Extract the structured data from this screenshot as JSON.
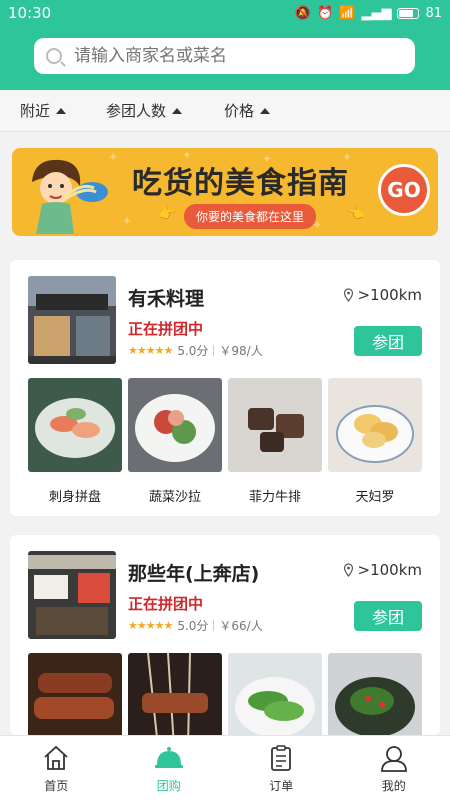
{
  "status_bar": {
    "time": "10:30",
    "battery": "81"
  },
  "search": {
    "placeholder": "请输入商家名或菜名"
  },
  "filters": [
    {
      "label": "附近"
    },
    {
      "label": "参团人数"
    },
    {
      "label": "价格"
    }
  ],
  "banner": {
    "title": "吃货的美食指南",
    "subtitle": "你要的美食都在这里",
    "go": "GO"
  },
  "shops": [
    {
      "name": "有禾料理",
      "distance": ">100km",
      "status": "正在拼团中",
      "rating": "5.0分",
      "price": "￥98/人",
      "join_label": "参团",
      "dishes": [
        {
          "name": "刺身拼盘"
        },
        {
          "name": "蔬菜沙拉"
        },
        {
          "name": "菲力牛排"
        },
        {
          "name": "天妇罗"
        }
      ]
    },
    {
      "name": "那些年(上奔店)",
      "distance": ">100km",
      "status": "正在拼团中",
      "rating": "5.0分",
      "price": "￥66/人",
      "join_label": "参团",
      "dishes": [
        {
          "name": ""
        },
        {
          "name": ""
        },
        {
          "name": ""
        },
        {
          "name": ""
        }
      ]
    }
  ],
  "tabbar": [
    {
      "label": "首页"
    },
    {
      "label": "团购"
    },
    {
      "label": "订单"
    },
    {
      "label": "我的"
    }
  ],
  "colors": {
    "brand": "#2fc59a",
    "accent_red": "#d0272b",
    "banner": "#f6b82e"
  }
}
